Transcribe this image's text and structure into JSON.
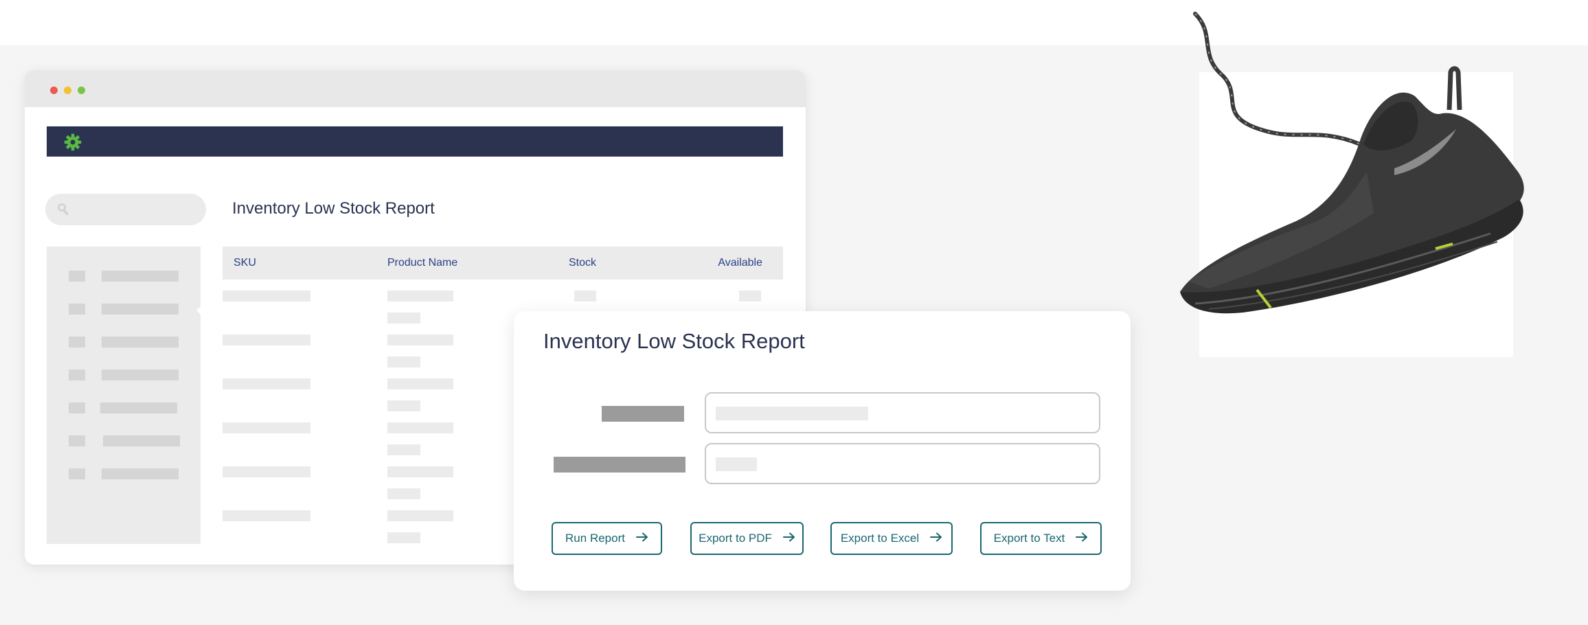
{
  "browser": {
    "window_dots": [
      "#ea5a4f",
      "#f2c131",
      "#7cc447"
    ],
    "navbar": {
      "background": "#2b3350",
      "icon": "gear-icon",
      "icon_color": "#59b947"
    },
    "search": {
      "icon": "search-icon"
    },
    "report_title": "Inventory Low Stock Report",
    "table": {
      "columns": [
        "SKU",
        "Product Name",
        "Stock",
        "Available"
      ]
    }
  },
  "dialog": {
    "title": "Inventory Low Stock Report",
    "buttons": [
      {
        "label": "Run Report",
        "icon": "arrow-right-icon"
      },
      {
        "label": "Export to PDF",
        "icon": "arrow-right-icon"
      },
      {
        "label": "Export to Excel",
        "icon": "arrow-right-icon"
      },
      {
        "label": "Export to Text",
        "icon": "arrow-right-icon"
      }
    ],
    "accent": "#18676f"
  },
  "product": {
    "image": "running-shoe"
  }
}
